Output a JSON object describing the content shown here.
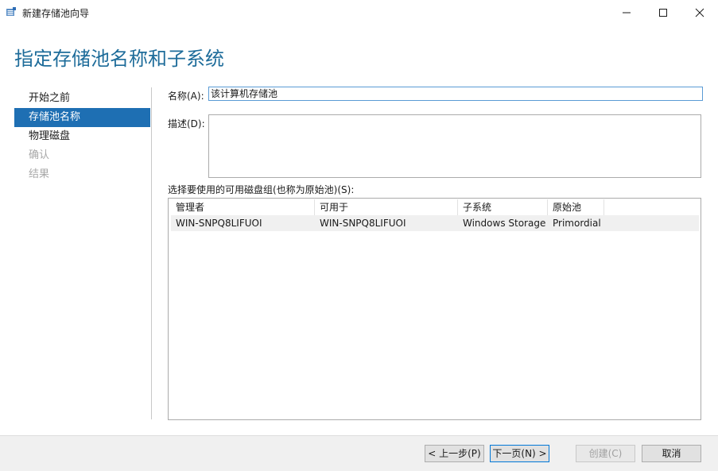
{
  "window": {
    "title": "新建存储池向导"
  },
  "page": {
    "heading": "指定存储池名称和子系统"
  },
  "nav": {
    "items": [
      {
        "label": "开始之前",
        "state": "normal"
      },
      {
        "label": "存储池名称",
        "state": "active"
      },
      {
        "label": "物理磁盘",
        "state": "normal"
      },
      {
        "label": "确认",
        "state": "disabled"
      },
      {
        "label": "结果",
        "state": "disabled"
      }
    ]
  },
  "form": {
    "name_label": "名称(A):",
    "name_value": "该计算机存储池",
    "desc_label": "描述(D):",
    "desc_value": "",
    "group_label": "选择要使用的可用磁盘组(也称为原始池)(S):"
  },
  "table": {
    "headers": [
      "管理者",
      "可用于",
      "子系统",
      "原始池"
    ],
    "rows": [
      [
        "WIN-SNPQ8LIFUOI",
        "WIN-SNPQ8LIFUOI",
        "Windows Storage",
        "Primordial"
      ]
    ]
  },
  "footer": {
    "prev_label": "< 上一步(P)",
    "next_label": "下一页(N) >",
    "create_label": "创建(C)",
    "cancel_label": "取消"
  },
  "colors": {
    "heading": "#1e6c9a",
    "nav_active_bg": "#1e6fb3",
    "disabled_text": "#a8a8a8"
  },
  "icons": {
    "app": "storage-pool-wizard-icon",
    "minimize": "minimize-icon",
    "maximize": "maximize-icon",
    "close": "close-icon"
  }
}
